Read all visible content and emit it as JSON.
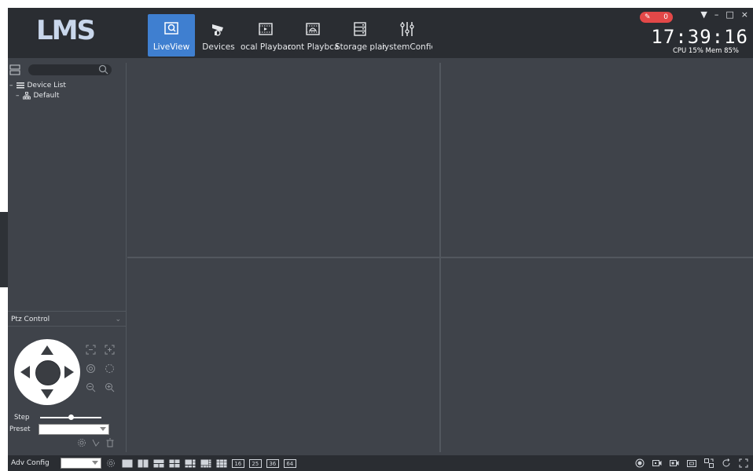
{
  "app": {
    "logo_text": "LMS"
  },
  "nav": {
    "items": [
      {
        "label": "LiveView",
        "icon": "liveview-icon",
        "active": true
      },
      {
        "label": "Devices",
        "icon": "camera-icon",
        "active": false
      },
      {
        "label": "ocal Playbac",
        "icon": "local-playback-icon",
        "active": false
      },
      {
        "label": "ront Playbca",
        "icon": "front-playback-icon",
        "active": false
      },
      {
        "label": "Storage plan",
        "icon": "storage-plan-icon",
        "active": false
      },
      {
        "label": "iystemConfic",
        "icon": "system-config-icon",
        "active": false
      }
    ]
  },
  "header": {
    "alarm_count": "0",
    "clock": "17:39:16",
    "cpu": "CPU 15%",
    "mem": "Mem 85%",
    "window_buttons": [
      "▼",
      "–",
      "□",
      "×"
    ]
  },
  "sidebar": {
    "search_placeholder": "",
    "tree": [
      {
        "label": "Device List",
        "expander": "–"
      },
      {
        "label": "Default",
        "expander": "–"
      }
    ]
  },
  "ptz": {
    "title": "Ptz Control",
    "step_label": "Step",
    "step_value": 0.5,
    "preset_label": "Preset",
    "preset_value": ""
  },
  "bottombar": {
    "adv_config_label": "Adv Config",
    "adv_config_value": "",
    "layout_numbers": [
      "16",
      "25",
      "36",
      "64"
    ]
  },
  "colors": {
    "header_bg": "#2a2d32",
    "panel_bg": "#3f434a",
    "accent": "#3f7fd0",
    "alarm": "#e34848"
  }
}
